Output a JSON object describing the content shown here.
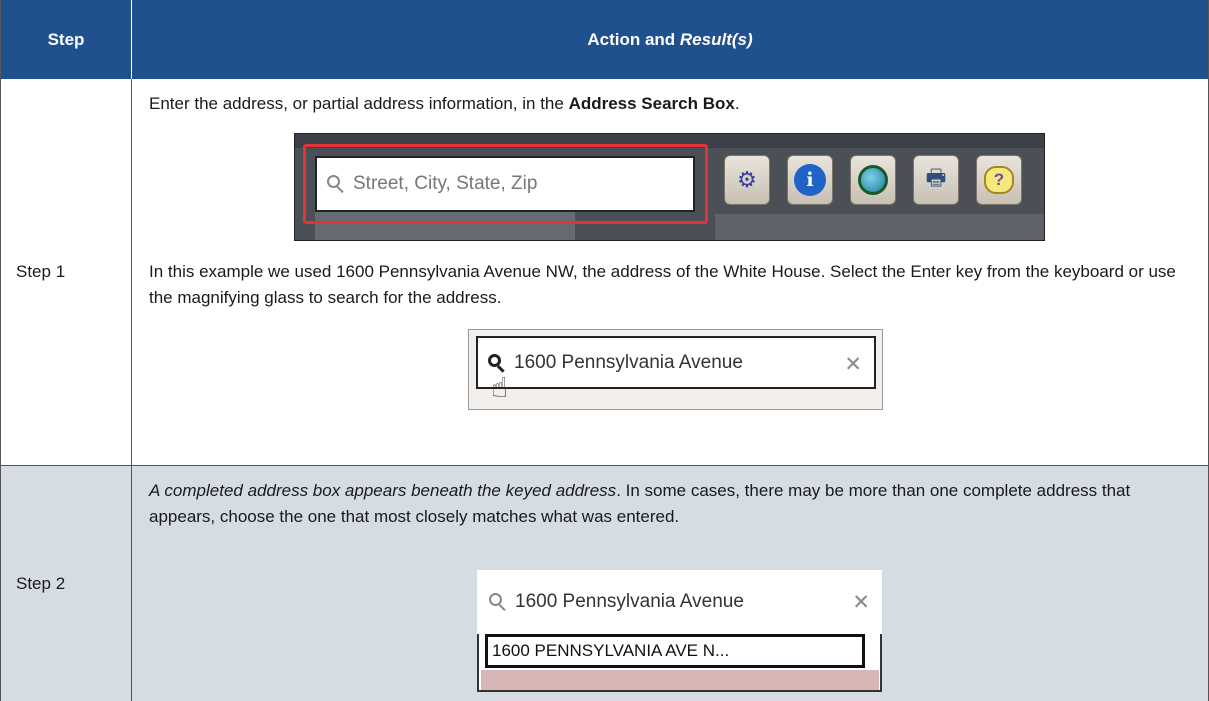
{
  "header": {
    "step_col": "Step",
    "action_col_prefix": "Action and ",
    "action_col_italic": "Result(s)"
  },
  "rows": [
    {
      "step": "Step 1",
      "para1_a": "Enter the address, or partial address information, in the ",
      "para1_b": "Address Search Box",
      "para1_c": ".",
      "para2": "In this example we used 1600 Pennsylvania Avenue NW, the address of the White House. Select the Enter key from the keyboard or use the magnifying glass to search for the address.",
      "toolbar_placeholder": "Street, City, State, Zip",
      "toolbar_icons": [
        "gear-icon",
        "info-icon",
        "zoom-globe-icon",
        "print-icon",
        "help-icon"
      ],
      "search_value": "1600 Pennsylvania Avenue"
    },
    {
      "step": "Step 2",
      "para_italic": "A completed address box appears beneath the keyed address",
      "para_rest": ". In some cases, there may be more than one complete address that appears, choose the one that most closely matches what was entered.",
      "search_value": "1600 Pennsylvania Avenue",
      "suggestion": "1600 PENNSYLVANIA AVE N..."
    }
  ],
  "colors": {
    "header_bg": "#20508e",
    "row2_bg": "#d5dce4",
    "highlight": "#e53238"
  }
}
